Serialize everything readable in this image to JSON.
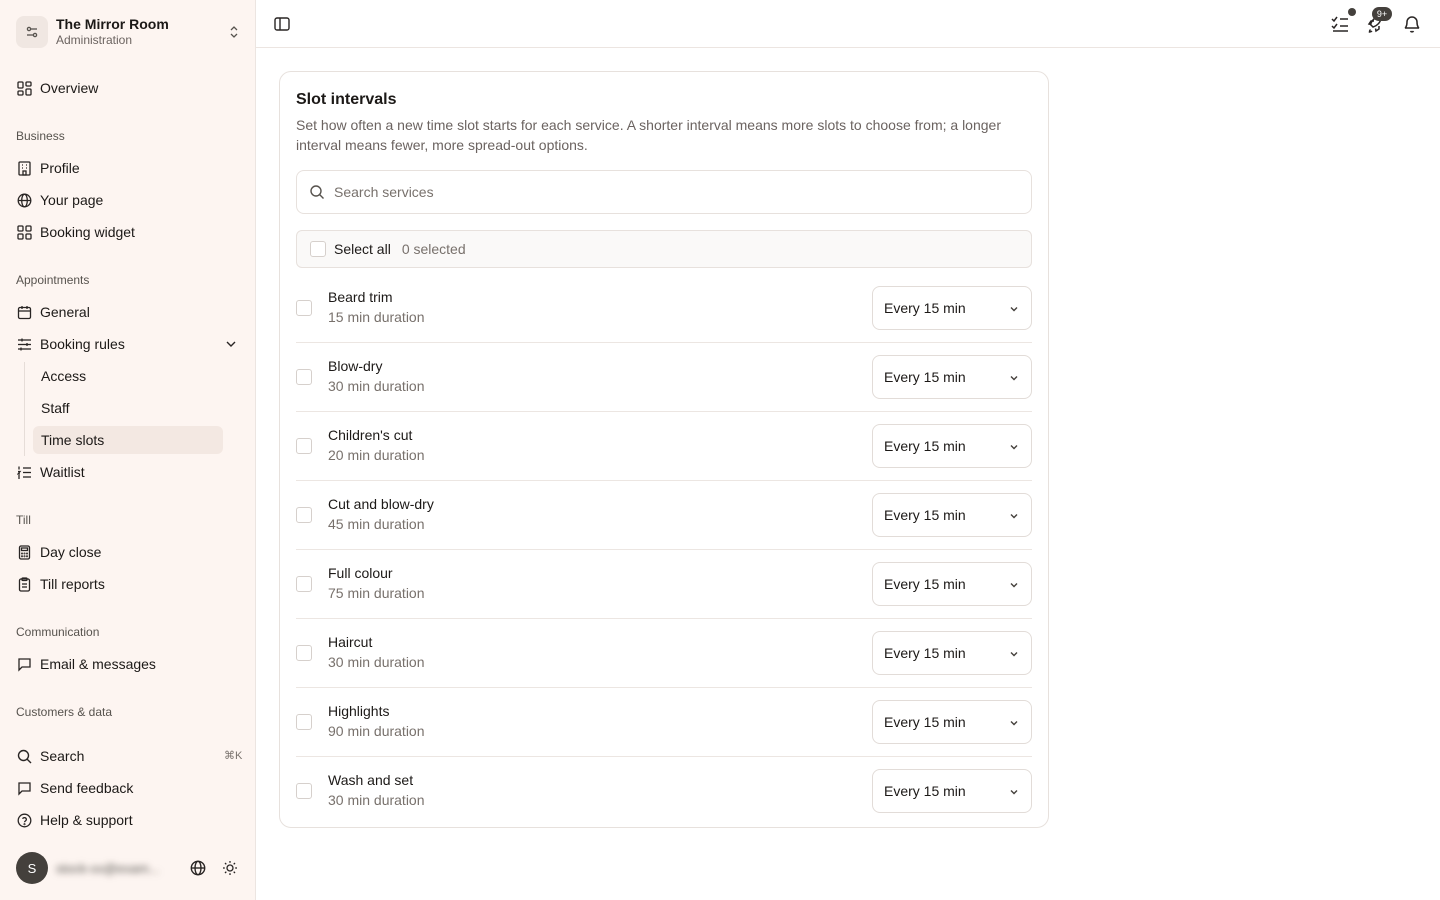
{
  "org": {
    "name": "The Mirror Room",
    "subtitle": "Administration"
  },
  "nav": {
    "overview": "Overview",
    "sections": {
      "business": "Business",
      "appointments": "Appointments",
      "till": "Till",
      "communication": "Communication",
      "customers": "Customers & data"
    },
    "business": [
      "Profile",
      "Your page",
      "Booking widget"
    ],
    "appointments": {
      "general": "General",
      "booking_rules": "Booking rules",
      "waitlist": "Waitlist"
    },
    "booking_rules_sub": [
      "Access",
      "Staff",
      "Time slots"
    ],
    "active_sub": "Time slots",
    "till": [
      "Day close",
      "Till reports"
    ],
    "communication": [
      "Email & messages"
    ],
    "footer": {
      "search": "Search",
      "shortcut": "⌘K",
      "feedback": "Send feedback",
      "help": "Help & support"
    }
  },
  "user": {
    "initial": "S",
    "email": "stock-xx@exam..."
  },
  "topbar": {
    "badge_count": "9+"
  },
  "card": {
    "title": "Slot intervals",
    "description": "Set how often a new time slot starts for each service. A shorter interval means more slots to choose from; a longer interval means fewer, more spread-out options.",
    "search_placeholder": "Search services",
    "select_all": "Select all",
    "selected_count": "0 selected"
  },
  "services": [
    {
      "name": "Beard trim",
      "duration": "15 min duration",
      "interval": "Every 15 min"
    },
    {
      "name": "Blow-dry",
      "duration": "30 min duration",
      "interval": "Every 15 min"
    },
    {
      "name": "Children's cut",
      "duration": "20 min duration",
      "interval": "Every 15 min"
    },
    {
      "name": "Cut and blow-dry",
      "duration": "45 min duration",
      "interval": "Every 15 min"
    },
    {
      "name": "Full colour",
      "duration": "75 min duration",
      "interval": "Every 15 min"
    },
    {
      "name": "Haircut",
      "duration": "30 min duration",
      "interval": "Every 15 min"
    },
    {
      "name": "Highlights",
      "duration": "90 min duration",
      "interval": "Every 15 min"
    },
    {
      "name": "Wash and set",
      "duration": "30 min duration",
      "interval": "Every 15 min"
    }
  ],
  "colors": {
    "sidebar_bg": "#fdf5f1",
    "active_item": "#f3e8e2",
    "border": "#e7e1dd",
    "text_muted": "#78716c"
  }
}
